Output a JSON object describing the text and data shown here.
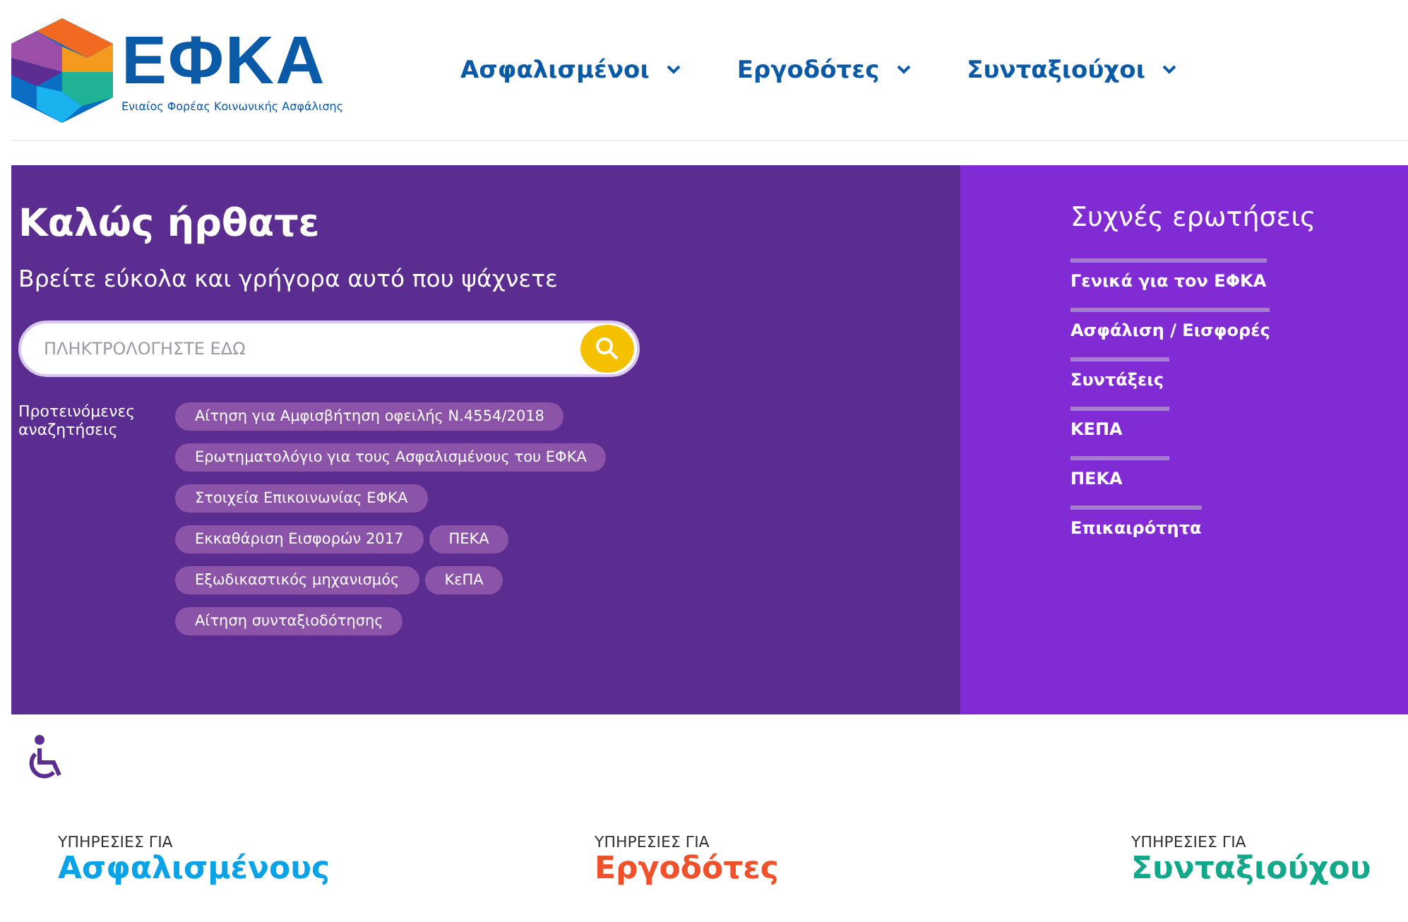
{
  "logo": {
    "wordmark": "ΕΦΚΑ",
    "tagline": "Ενιαίος Φορέας Κοινωνικής Ασφάλισης"
  },
  "nav": [
    {
      "label": "Ασφαλισμένοι",
      "expanded": false
    },
    {
      "label": "Εργοδότες",
      "expanded": false
    },
    {
      "label": "Συνταξιούχοι",
      "expanded": false
    }
  ],
  "hero": {
    "title": "Καλώς ήρθατε",
    "subtitle": "Βρείτε εύκολα και γρήγορα αυτό που ψάχνετε",
    "search": {
      "placeholder": "ΠΛΗΚΤΡΟΛΟΓΗΣΤΕ ΕΔΩ"
    },
    "suggested_label": "Προτεινόμενες αναζητήσεις",
    "suggestions": [
      [
        "Αίτηση για Αμφισβήτηση οφειλής Ν.4554/2018"
      ],
      [
        "Ερωτηματολόγιο για τους Ασφαλισμένους του ΕΦΚΑ"
      ],
      [
        "Στοιχεία Επικοινωνίας ΕΦΚΑ"
      ],
      [
        "Εκκαθάριση Εισφορών 2017",
        "ΠΕΚΑ"
      ],
      [
        "Εξωδικαστικός μηχανισμός",
        "ΚεΠΑ"
      ],
      [
        "Αίτηση συνταξιοδότησης"
      ]
    ]
  },
  "faq": {
    "title": "Συχνές ερωτήσεις",
    "items": [
      "Γενικά για τον ΕΦΚΑ",
      "Ασφάλιση / Εισφορές",
      "Συντάξεις",
      "ΚΕΠΑ",
      "ΠΕΚΑ",
      "Επικαιρότητα"
    ]
  },
  "services": [
    {
      "caption": "ΥΠΗΡΕΣΙΕΣ ΓΙΑ",
      "title": "Ασφαλισμένους",
      "color": "#0aa3e8"
    },
    {
      "caption": "ΥΠΗΡΕΣΙΕΣ ΓΙΑ",
      "title": "Εργοδότες",
      "color": "#f0502a"
    },
    {
      "caption": "ΥΠΗΡΕΣΙΕΣ ΓΙΑ",
      "title": "Συνταξιούχου",
      "color": "#14a88a"
    }
  ]
}
